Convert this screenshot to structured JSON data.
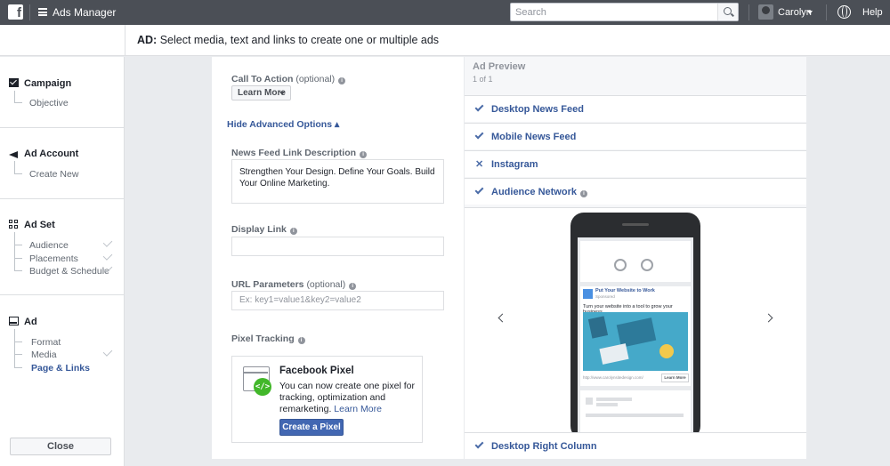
{
  "topbar": {
    "logo": "f",
    "app_title": "Ads Manager",
    "search_placeholder": "Search",
    "user_name": "Carolyn",
    "help": "Help"
  },
  "header": {
    "title_prefix": "AD:",
    "title_text": " Select media, text and links to create one or multiple ads"
  },
  "sidebar": {
    "sections": [
      {
        "title": "Campaign",
        "items": [
          {
            "label": "Objective",
            "checked": false
          }
        ]
      },
      {
        "title": "Ad Account",
        "items": [
          {
            "label": "Create New",
            "checked": false
          }
        ]
      },
      {
        "title": "Ad Set",
        "items": [
          {
            "label": "Audience",
            "checked": true
          },
          {
            "label": "Placements",
            "checked": true
          },
          {
            "label": "Budget & Schedule",
            "checked": true
          }
        ]
      },
      {
        "title": "Ad",
        "items": [
          {
            "label": "Format",
            "checked": false
          },
          {
            "label": "Media",
            "checked": true
          },
          {
            "label": "Page & Links",
            "checked": false,
            "active": true
          }
        ]
      }
    ],
    "close_label": "Close"
  },
  "form": {
    "cta_label": "Call To Action",
    "cta_optional": "(optional)",
    "cta_value": "Learn More",
    "advanced_link": "Hide Advanced Options",
    "advanced_suffix": "▴",
    "desc_label": "News Feed Link Description",
    "desc_value": "Strengthen Your Design. Define Your Goals. Build Your Online Marketing.",
    "display_link_label": "Display Link",
    "display_link_value": "",
    "url_params_label": "URL Parameters",
    "url_params_optional": "(optional)",
    "url_params_placeholder": "Ex: key1=value1&key2=value2",
    "pixel_label": "Pixel Tracking",
    "pixel": {
      "title": "Facebook Pixel",
      "description": "You can now create one pixel for tracking, optimization and remarketing.",
      "learn_more": "Learn More",
      "button": "Create a Pixel",
      "code_glyph": "</>"
    }
  },
  "preview": {
    "title": "Ad Preview",
    "count": "1 of 1",
    "placements": [
      {
        "label": "Desktop News Feed",
        "status": "check"
      },
      {
        "label": "Mobile News Feed",
        "status": "check"
      },
      {
        "label": "Instagram",
        "status": "x"
      },
      {
        "label": "Audience Network",
        "status": "check",
        "info": true
      }
    ],
    "last_placement": {
      "label": "Desktop Right Column",
      "status": "check"
    },
    "mock_ad": {
      "headline": "Put Your Website to Work",
      "sponsored": "Sponsored",
      "text": "Turn your website into a tool to grow your business.",
      "url": "http://www.carolynsitedesign.com/",
      "button": "Learn More"
    }
  },
  "colors": {
    "topbar_bg": "#4b4f56",
    "link_blue": "#365899",
    "button_blue": "#4267b2",
    "pixel_green": "#42b72a"
  }
}
